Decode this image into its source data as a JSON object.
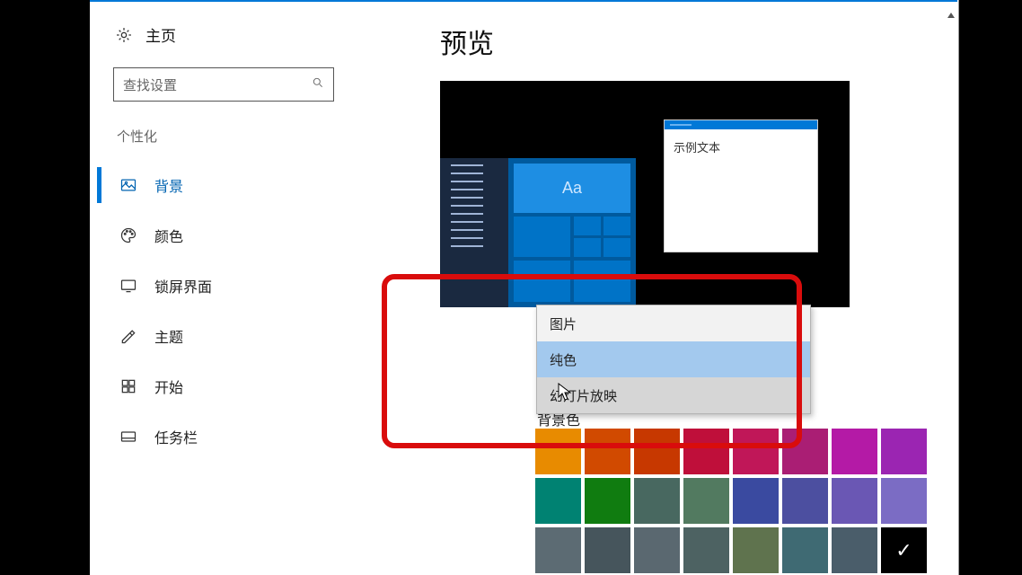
{
  "sidebar": {
    "home_label": "主页",
    "search_placeholder": "查找设置",
    "section_label": "个性化",
    "items": [
      {
        "key": "background",
        "label": "背景",
        "active": true
      },
      {
        "key": "colors",
        "label": "颜色"
      },
      {
        "key": "lockscreen",
        "label": "锁屏界面"
      },
      {
        "key": "themes",
        "label": "主题"
      },
      {
        "key": "start",
        "label": "开始"
      },
      {
        "key": "taskbar",
        "label": "任务栏"
      }
    ]
  },
  "content": {
    "preview_heading": "预览",
    "sample_window_text": "示例文本",
    "preview_tile_text": "Aa",
    "background_label_partial": "背景色"
  },
  "dropdown": {
    "options": [
      {
        "key": "picture",
        "label": "图片"
      },
      {
        "key": "solid",
        "label": "纯色",
        "highlight": true
      },
      {
        "key": "slideshow",
        "label": "幻灯片放映",
        "hover": true
      }
    ]
  },
  "swatches": {
    "selected_index": 23,
    "colors": [
      "#e88b00",
      "#d14a00",
      "#c73800",
      "#bf0f3a",
      "#c01758",
      "#aa1e74",
      "#b41aa6",
      "#9b25b2",
      "#008272",
      "#107c10",
      "#486860",
      "#527a60",
      "#3a4aa0",
      "#4c4fa0",
      "#6a57b4",
      "#7b6cc4",
      "#5c6b73",
      "#46555c",
      "#5a6870",
      "#4d6262",
      "#5f734e",
      "#3f6a73",
      "#4a5d6a",
      "#000000"
    ]
  }
}
